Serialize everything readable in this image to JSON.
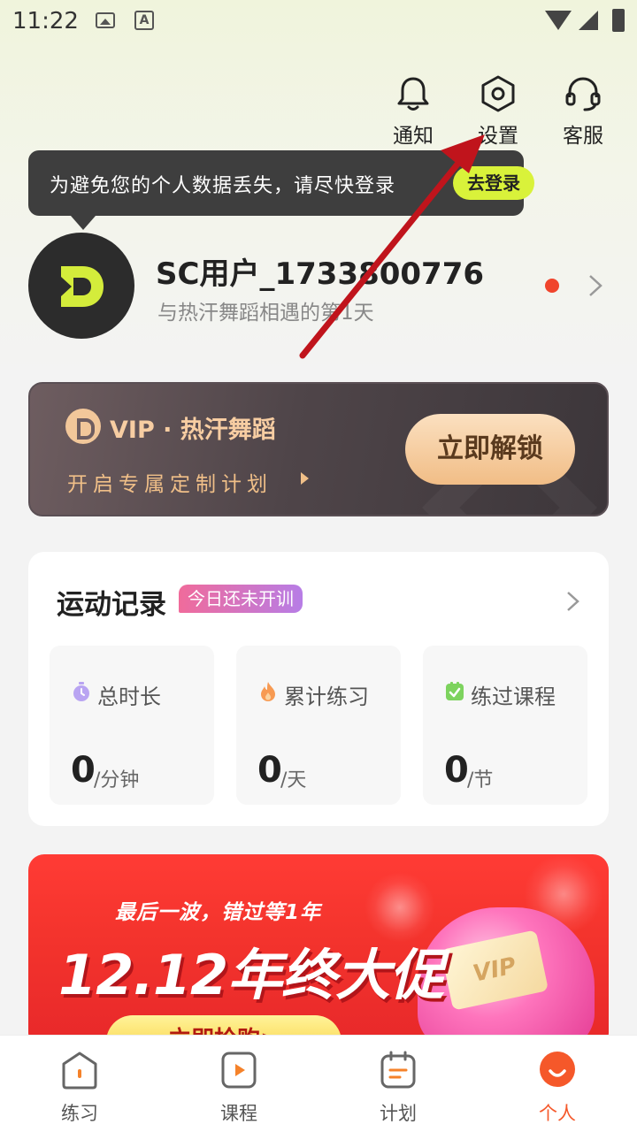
{
  "status_bar": {
    "time": "11:22"
  },
  "header": {
    "notify_label": "通知",
    "settings_label": "设置",
    "service_label": "客服"
  },
  "tooltip": {
    "text": "为避免您的个人数据丢失，请尽快登录",
    "login_label": "去登录"
  },
  "profile": {
    "username": "SC用户_1733800776",
    "subtitle": "与热汗舞蹈相遇的第1天"
  },
  "vip": {
    "title": "VIP · 热汗舞蹈",
    "subtitle": "开启专属定制计划",
    "button_label": "立即解锁"
  },
  "record": {
    "title": "运动记录",
    "badge": "今日还未开训",
    "stats": [
      {
        "label": "总时长",
        "value": "0",
        "unit": "/分钟",
        "icon": "stopwatch-icon"
      },
      {
        "label": "累计练习",
        "value": "0",
        "unit": "/天",
        "icon": "flame-icon"
      },
      {
        "label": "练过课程",
        "value": "0",
        "unit": "/节",
        "icon": "checkbox-icon"
      }
    ]
  },
  "promo": {
    "subtitle": "最后一波，错过等1年",
    "title": "12.12年终大促",
    "button_label": "立即抢购>",
    "card_text": "VIP"
  },
  "bottom_nav": {
    "items": [
      {
        "label": "练习",
        "icon": "home-icon"
      },
      {
        "label": "课程",
        "icon": "play-icon"
      },
      {
        "label": "计划",
        "icon": "calendar-icon"
      },
      {
        "label": "个人",
        "icon": "profile-icon"
      }
    ],
    "active_index": 3
  },
  "colors": {
    "accent": "#f5582a",
    "login_button": "#d9f23a",
    "vip_gold": "#f7cda2",
    "promo_red": "#f4342d",
    "annotation_arrow": "#c0141c"
  }
}
